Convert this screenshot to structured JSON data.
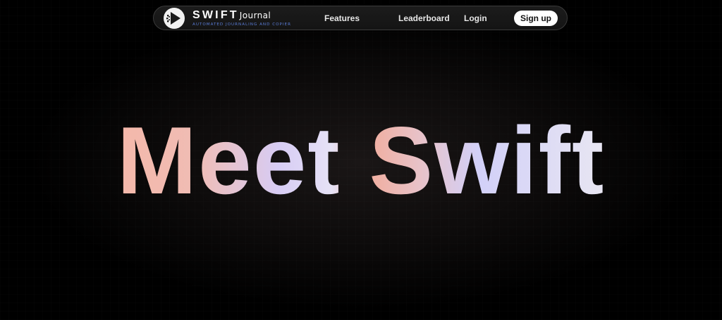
{
  "brand": {
    "name": "SWIFT",
    "suffix": "Journal",
    "tagline": "AUTOMATED JOURNALING AND COPIER"
  },
  "nav": {
    "features": "Features",
    "leaderboard": "Leaderboard",
    "login": "Login",
    "signup": "Sign up"
  },
  "hero": {
    "title": "Meet Swift"
  },
  "colors": {
    "background": "#000000",
    "navbar": "#161616",
    "tagline": "#5a7cd6",
    "hero_gradient": [
      "#f4b8aa",
      "#d7ccf4",
      "#f0aea0",
      "#d2d0f8",
      "#e8e6f2"
    ]
  },
  "icons": {
    "logo": "play-arrow-logo-icon"
  }
}
